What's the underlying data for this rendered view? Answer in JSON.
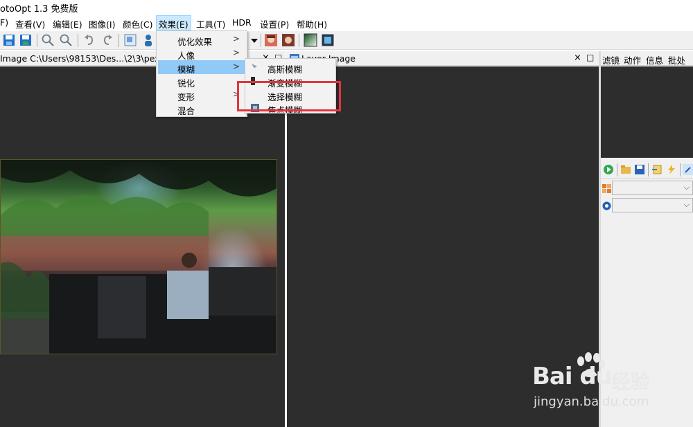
{
  "window": {
    "title": "otoOpt 1.3 免费版"
  },
  "menubar": {
    "items": [
      "F)",
      "查看(V)",
      "编辑(E)",
      "图像(I)",
      "颜色(C)",
      "效果(E)",
      "工具(T)",
      "HDR",
      "设置(P)",
      "帮助(H)"
    ]
  },
  "left_panel": {
    "title": "Image C:\\Users\\98153\\Des...\\2\\3\\pex"
  },
  "layer_panel": {
    "title": "Layer Image",
    "close": "×",
    "maximize": "□"
  },
  "effects_menu": {
    "items": [
      {
        "label": "优化效果",
        "arrow": ">"
      },
      {
        "label": "人像",
        "arrow": ">"
      },
      {
        "label": "模糊",
        "arrow": ">"
      },
      {
        "label": "锐化",
        "arrow": ""
      },
      {
        "label": "变形",
        "arrow": ">"
      },
      {
        "label": "混合",
        "arrow": ""
      }
    ]
  },
  "blur_submenu": {
    "items": [
      "高斯模糊",
      "渐变模糊",
      "选择模糊",
      "焦点模糊"
    ]
  },
  "right_panel": {
    "tabs": [
      "滤镜",
      "动作",
      "信息",
      "批处理"
    ]
  },
  "watermark": {
    "logo": "Bai du",
    "brand": "经验",
    "url": "jingyan.baidu.com"
  },
  "colors": {
    "menu_highlight": "#91c9f7",
    "annotation_box": "#e8323c",
    "canvas": "#2d2d2d"
  }
}
